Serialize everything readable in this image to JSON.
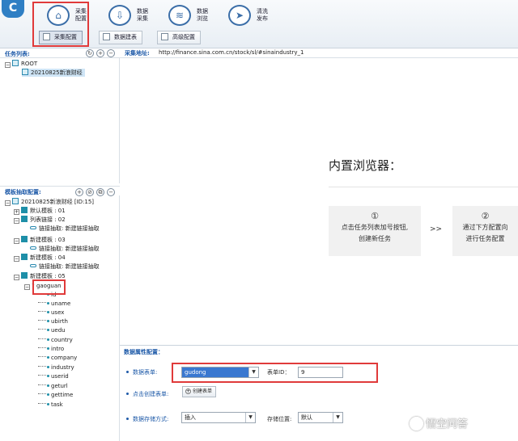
{
  "toolbar": {
    "app_logo": "C",
    "tools": [
      {
        "label": "采集\n配置",
        "icon": "home-icon"
      },
      {
        "label": "数据\n采集",
        "icon": "download-icon"
      },
      {
        "label": "数据\n浏览",
        "icon": "layers-icon"
      },
      {
        "label": "清洗\n发布",
        "icon": "send-icon"
      }
    ],
    "sub_buttons": [
      "采集配置",
      "数据建表",
      "高级配置"
    ]
  },
  "task_panel": {
    "title": "任务列表:",
    "root": "ROOT",
    "task": "20210825新浪财经"
  },
  "template_panel": {
    "title": "模板抽取配置:",
    "task_node": "20210825新浪财经 [ID:15]",
    "nodes": [
      {
        "label": "默认模板 : 01"
      },
      {
        "label": "列表链接 : 02",
        "child": "链接抽取: 新建链接抽取"
      },
      {
        "label": "新建模板 : 03",
        "child": "链接抽取: 新建链接抽取"
      },
      {
        "label": "新建模板 : 04",
        "child": "链接抽取: 新建链接抽取"
      },
      {
        "label": "新建模板 : 05"
      }
    ],
    "group": "gaoguan",
    "fields": [
      "id",
      "uname",
      "usex",
      "ubirth",
      "uedu",
      "country",
      "intro",
      "company",
      "industry",
      "userid",
      "geturl",
      "gettime",
      "task"
    ]
  },
  "url_bar": {
    "label": "采集地址:",
    "value": "http://finance.sina.com.cn/stock/sl/#sinaindustry_1"
  },
  "browser": {
    "title": "内置浏览器：",
    "steps": [
      {
        "num": "①",
        "line1": "点击任务列表加号按钮,",
        "line2": "创建新任务"
      },
      {
        "num": "②",
        "line1": "通过下方配置向",
        "line2": "进行任务配置"
      }
    ],
    "arrow": ">>"
  },
  "config": {
    "title": "数据属性配置：",
    "table_label": "数据表单:",
    "table_value": "gudong",
    "table_id_label": "表单ID：",
    "table_id_value": "9",
    "create_label": "点击创建表单:",
    "create_button": "创建表单",
    "storage_label": "数据存储方式:",
    "storage_value": "插入",
    "location_label": "存储位置:",
    "location_value": "默认"
  },
  "watermark": "悟空问答"
}
